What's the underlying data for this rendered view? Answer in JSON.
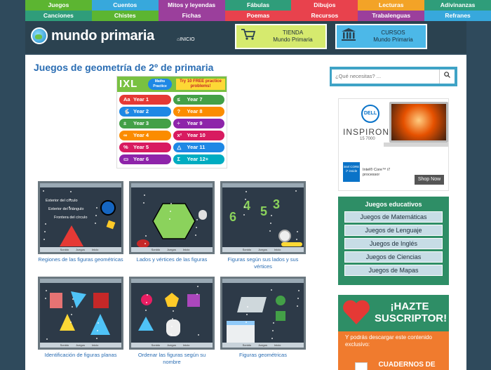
{
  "nav": {
    "row1": [
      {
        "label": "Juegos",
        "color": "#5cb531"
      },
      {
        "label": "Cuentos",
        "color": "#37a8dc"
      },
      {
        "label": "Mitos y leyendas",
        "color": "#9b3f9c"
      },
      {
        "label": "Fábulas",
        "color": "#2f9d7a"
      },
      {
        "label": "Dibujos",
        "color": "#e8424d"
      },
      {
        "label": "Lecturas",
        "color": "#f3a327"
      },
      {
        "label": "Adivinanzas",
        "color": "#2f9d7a"
      }
    ],
    "row2": [
      {
        "label": "Canciones",
        "color": "#2f9d7a"
      },
      {
        "label": "Chistes",
        "color": "#5cb531"
      },
      {
        "label": "Fichas",
        "color": "#9b3f9c"
      },
      {
        "label": "Poemas",
        "color": "#e8424d"
      },
      {
        "label": "Recursos",
        "color": "#e8424d"
      },
      {
        "label": "Trabalenguas",
        "color": "#9b3f9c"
      },
      {
        "label": "Refranes",
        "color": "#37a8dc"
      }
    ]
  },
  "header": {
    "logo_text": "mundo primaria",
    "home_label": "INICIO",
    "tienda_line1": "TIENDA",
    "tienda_line2": "Mundo Primaria",
    "cursos_line1": "CURSOS",
    "cursos_line2": "Mundo Primaria"
  },
  "page": {
    "title": "Juegos de geometría de 2º de primaria"
  },
  "ixl": {
    "logo": "IXL",
    "badge": "Maths Practice",
    "try_text": "Try 10 FREE practice problems!",
    "years": [
      {
        "icon": "Aa",
        "label": "Year 1",
        "color": "#e53935"
      },
      {
        "icon": "≤",
        "label": "Year 7",
        "color": "#43a047"
      },
      {
        "icon": "🐇",
        "label": "Year 2",
        "color": "#1e88e5"
      },
      {
        "icon": "?",
        "label": "Year 8",
        "color": "#fb8c00"
      },
      {
        "icon": "±",
        "label": "Year 3",
        "color": "#43a047"
      },
      {
        "icon": "÷",
        "label": "Year 9",
        "color": "#8e24aa"
      },
      {
        "icon": "∞",
        "label": "Year 4",
        "color": "#fb8c00"
      },
      {
        "icon": "x²",
        "label": "Year 10",
        "color": "#d81b60"
      },
      {
        "icon": "%",
        "label": "Year 5",
        "color": "#d81b60"
      },
      {
        "icon": "△",
        "label": "Year 11",
        "color": "#1e88e5"
      },
      {
        "icon": "▭",
        "label": "Year 6",
        "color": "#8e24aa"
      },
      {
        "icon": "Σ",
        "label": "Year 12+",
        "color": "#00acc1"
      }
    ]
  },
  "games": [
    {
      "label": "Regiones de las figuras geométricas",
      "thumb_lines": [
        "Exterior del círculo",
        "Exterior del triángulo",
        "Frontera del círculo"
      ]
    },
    {
      "label": "Lados y vértices de las figuras"
    },
    {
      "label": "Figuras según sus lados y sus vértices",
      "thumb_numbers": [
        "4",
        "5",
        "3",
        "6"
      ]
    },
    {
      "label": "Identificación de figuras planas"
    },
    {
      "label": "Ordenar las figuras según su nombre"
    },
    {
      "label": "Figuras geométricas"
    }
  ],
  "thumb_footer": {
    "sonido": "Sonido",
    "juegos": "Juegos",
    "inicio": "Inicio"
  },
  "sidebar": {
    "search_placeholder": "¿Qué necesitas? ...",
    "dell_brand": "DELL",
    "dell_model": "INSPIRON",
    "dell_sub": "15 7000",
    "dell_chip": "intel CORE i7 inside",
    "dell_proc": "Intel® Core™ i7 processor",
    "dell_cta": "Shop Now",
    "box_title": "Juegos educativos",
    "box_items": [
      "Juegos de Matemáticas",
      "Juegos de Lenguaje",
      "Juegos de Inglés",
      "Juegos de Ciencias",
      "Juegos de Mapas"
    ],
    "subs_title": "¡HAZTE SUSCRIPTOR!",
    "subs_text": "Y podrás descargar este contenido exclusivo:",
    "subs_book": "CUADERNOS DE VERANO"
  }
}
